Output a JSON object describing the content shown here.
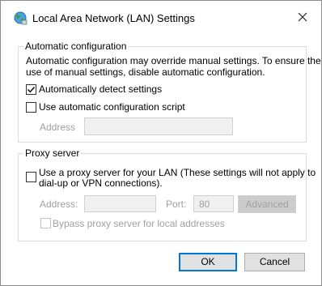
{
  "window": {
    "title": "Local Area Network (LAN) Settings"
  },
  "auto_config": {
    "legend": "Automatic configuration",
    "description_line1": "Automatic configuration may override manual settings.  To ensure the",
    "description_line2": "use of manual settings, disable automatic configuration.",
    "detect_label": "Automatically detect settings",
    "detect_checked": true,
    "script_label": "Use automatic configuration script",
    "script_checked": false,
    "address_label": "Address",
    "address_value": ""
  },
  "proxy": {
    "legend": "Proxy server",
    "use_proxy_line1": "Use a proxy server for your LAN (These settings will not apply to",
    "use_proxy_line2": "dial-up or VPN connections).",
    "use_proxy_checked": false,
    "address_label": "Address:",
    "address_value": "",
    "port_label": "Port:",
    "port_value": "80",
    "advanced_label": "Advanced",
    "bypass_label": "Bypass proxy server for local addresses",
    "bypass_checked": false
  },
  "buttons": {
    "ok": "OK",
    "cancel": "Cancel"
  },
  "icons": {
    "app": "globe-network-icon",
    "close": "close-icon",
    "check": "checkmark-icon"
  },
  "colors": {
    "accent": "#0078d7",
    "disabled_text": "#a0a0a0"
  }
}
